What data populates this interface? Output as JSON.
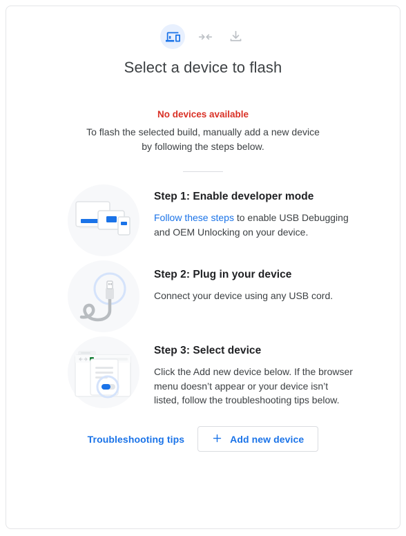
{
  "header": {
    "icons": [
      {
        "name": "devices-icon",
        "label": "devices",
        "active": true
      },
      {
        "name": "connect-arrows-icon",
        "label": "connect"
      },
      {
        "name": "download-icon",
        "label": "download"
      }
    ],
    "title": "Select a device to flash"
  },
  "status": {
    "message": "No devices available",
    "message_color": "#d93025",
    "description": "To flash the selected build, manually add a new device by following the steps below."
  },
  "steps": [
    {
      "title": "Step 1: Enable developer mode",
      "link_text": "Follow these steps",
      "desc_after_link": " to enable USB Debugging and OEM Unlocking on your device.",
      "illustration": "devices-illustration"
    },
    {
      "title": "Step 2: Plug in your device",
      "description": "Connect your device using any USB cord.",
      "illustration": "usb-cable-illustration"
    },
    {
      "title": "Step 3: Select device",
      "description": "Click the Add new device below. If the browser menu doesn’t appear or your device isn’t listed, follow the troubleshooting tips below.",
      "illustration": "browser-dialog-illustration"
    }
  ],
  "footer": {
    "troubleshooting_label": "Troubleshooting tips",
    "add_device_label": "Add new device",
    "add_device_icon": "plus-icon"
  },
  "colors": {
    "accent_blue": "#1a73e8",
    "error_red": "#d93025",
    "icon_chip_bg": "#e8f0fe",
    "illustration_bg": "#f7f8fa",
    "card_border": "#e4e5e7"
  }
}
